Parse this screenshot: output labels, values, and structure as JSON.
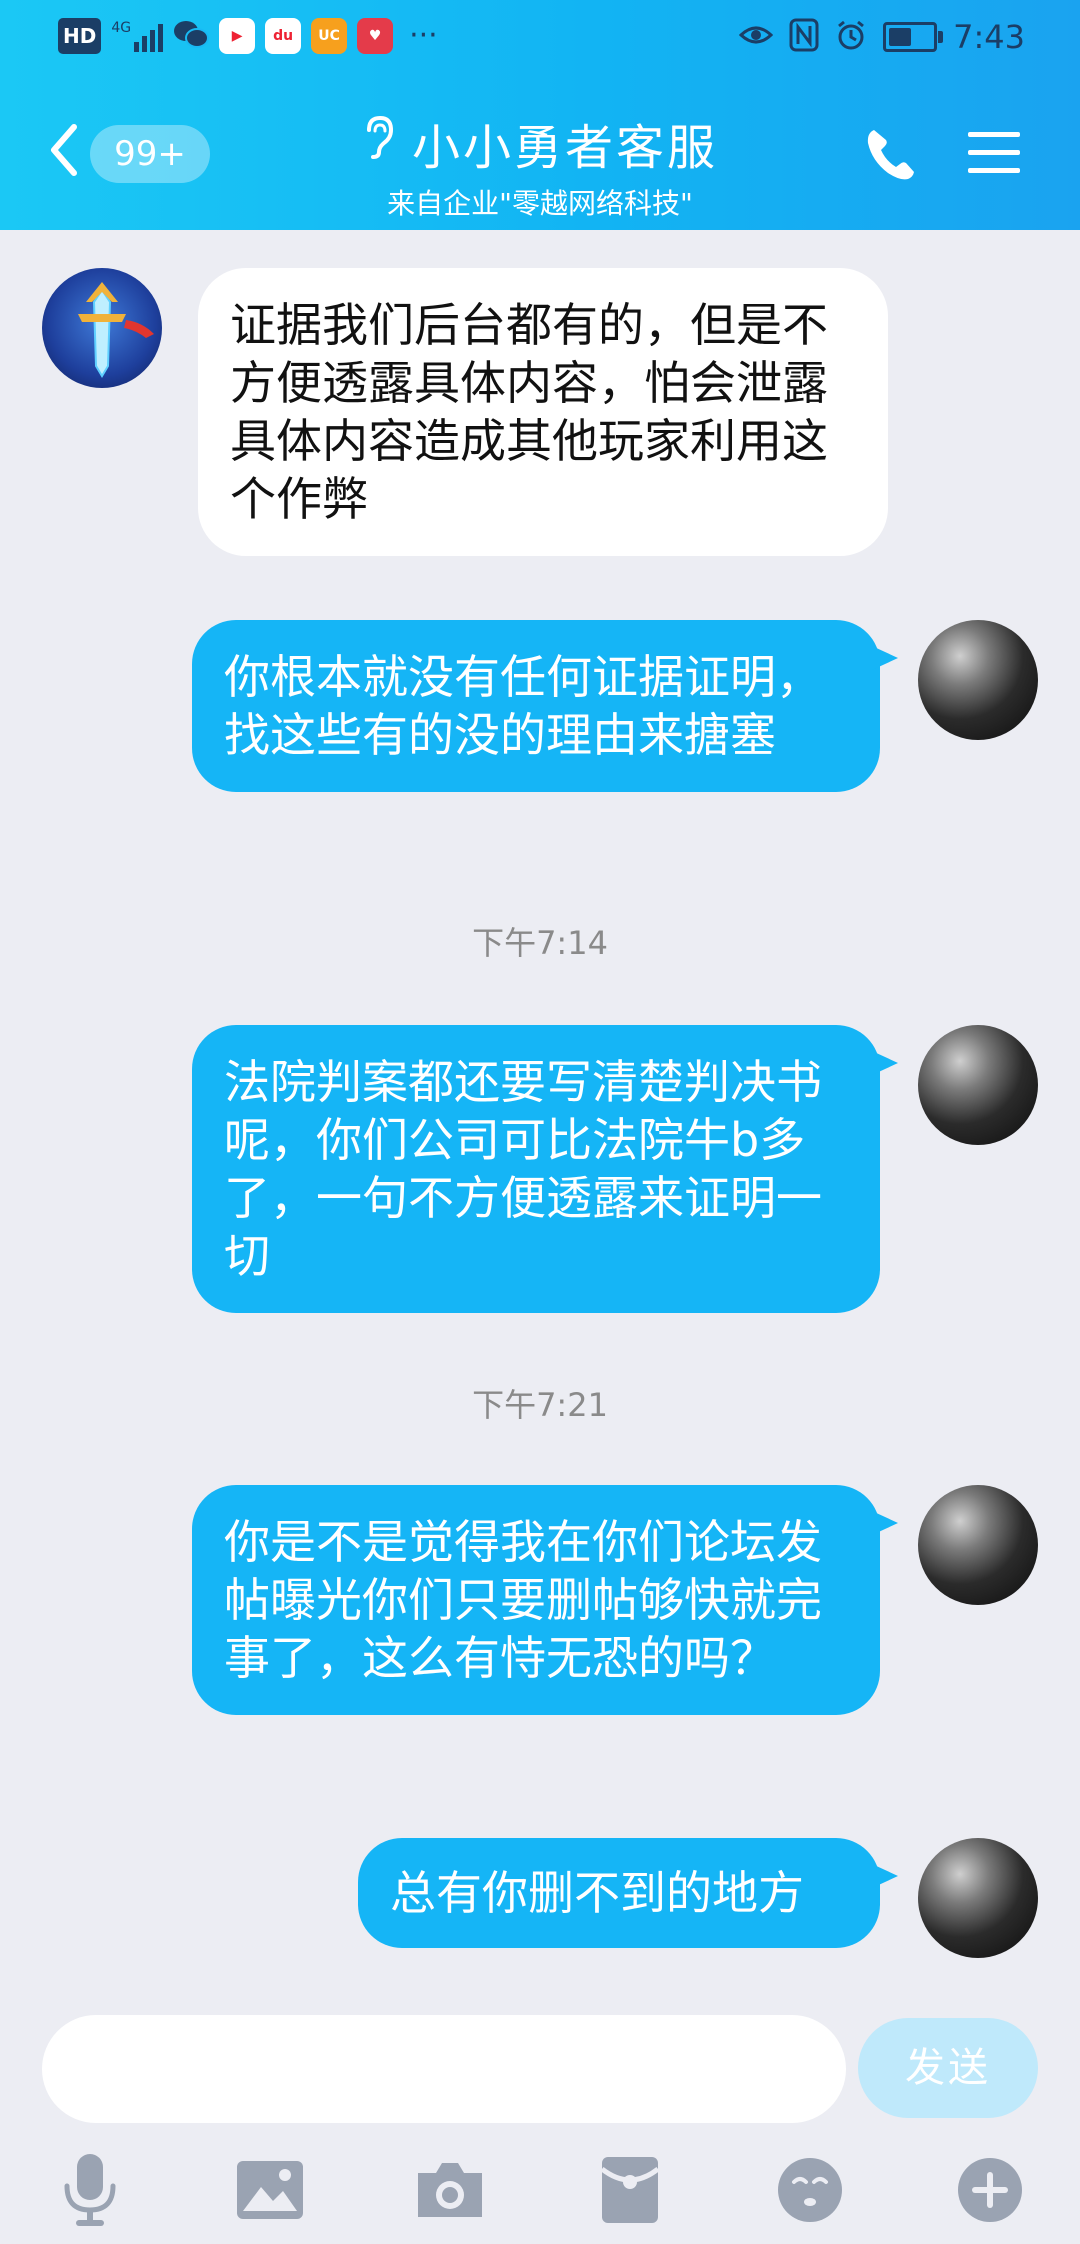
{
  "status_bar": {
    "signal_label": "HD",
    "network_label": "4G",
    "more": "···",
    "time": "7:43"
  },
  "header": {
    "unread_count": "99+",
    "title": "小小勇者客服",
    "subtitle": "来自企业\"零越网络科技\""
  },
  "messages": [
    {
      "from": "service",
      "text": "证据我们后台都有的，但是不方便透露具体内容，怕会泄露具体内容造成其他玩家利用这个作弊"
    },
    {
      "from": "me",
      "text": "你根本就没有任何证据证明，找这些有的没的理由来搪塞"
    },
    {
      "type": "time",
      "text": "下午7:14"
    },
    {
      "from": "me",
      "text": "法院判案都还要写清楚判决书呢，你们公司可比法院牛b多了，一句不方便透露来证明一切"
    },
    {
      "type": "time",
      "text": "下午7:21"
    },
    {
      "from": "me",
      "text": "你是不是觉得我在你们论坛发帖曝光你们只要删帖够快就完事了，这么有恃无恐的吗？"
    },
    {
      "from": "me",
      "text": "总有你删不到的地方"
    }
  ],
  "composer": {
    "placeholder": "",
    "send_label": "发送"
  },
  "toolbar_icons": [
    "mic-icon",
    "image-icon",
    "camera-icon",
    "red-packet-icon",
    "emoji-icon",
    "plus-icon"
  ],
  "colors": {
    "header_start": "#1bc8f5",
    "header_end": "#1aa3f0",
    "bubble_out": "#15b5f6",
    "bubble_in": "#ffffff",
    "background": "#ecedf3",
    "send_disabled": "#bfe9fb"
  }
}
